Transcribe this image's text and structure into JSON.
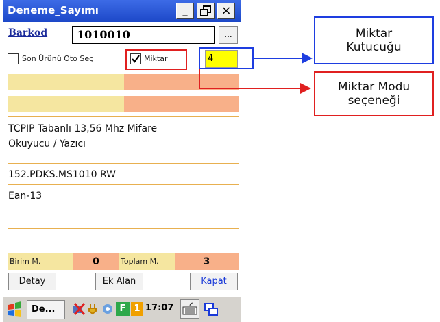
{
  "window": {
    "title": "Deneme_Sayımı",
    "minimize_glyph": "_",
    "restore_glyph": "❐",
    "close_glyph": "×"
  },
  "barkod": {
    "label": "Barkod",
    "value": "1010010",
    "browse_label": "..."
  },
  "options": {
    "son_urunu_label": "Son Ürünü Oto Seç",
    "son_urunu_checked": false,
    "miktar_label": "Miktar",
    "miktar_checked": true,
    "miktar_value": "4"
  },
  "colors": {
    "yellow_cell": "#f5e6a0",
    "salmon_cell": "#f8b089",
    "miktar_box": "#ffff00",
    "callout_blue": "#1e3ee0",
    "callout_red": "#e02020"
  },
  "product": {
    "name": "TCPIP Tabanlı 13,56 Mhz  Mifare Okuyucu / Yazıcı",
    "code": "152.PDKS.MS1010 RW",
    "barcode_type": "Ean-13"
  },
  "totals": {
    "birim_label": "Birim M.",
    "birim_value": "0",
    "toplam_label": "Toplam M.",
    "toplam_value": "3"
  },
  "buttons": {
    "detay": "Detay",
    "ek_alan": "Ek Alan",
    "kapat": "Kapat"
  },
  "taskbar": {
    "start_icon": "windows-flag-icon",
    "task_label": "De...",
    "time": "17:07",
    "badge_f": "F",
    "badge_1": "1"
  },
  "annotations": {
    "miktar_kutucugu": "Miktar Kutucuğu",
    "miktar_kutucugu_line1": "Miktar",
    "miktar_kutucugu_line2": "Kutucuğu",
    "miktar_modu_line1": "Miktar Modu",
    "miktar_modu_line2": "seçeneği"
  }
}
